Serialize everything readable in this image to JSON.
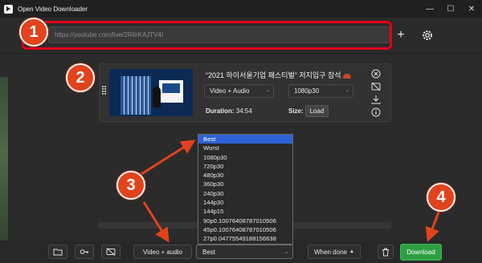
{
  "window": {
    "title": "Open Video Downloader",
    "controls": [
      "minimize",
      "maximize",
      "close"
    ]
  },
  "url_bar": {
    "value": "https://youtube.com/live/2R6rKAJTV4I",
    "add_label": "+"
  },
  "video": {
    "title": "“2021 하이서울기업 패스티벌” 저지입구 참석",
    "type": "Video + Audio",
    "quality": "1080p30",
    "duration_label": "Duration:",
    "duration": "34:54",
    "size_label": "Size:",
    "load_label": "Load"
  },
  "quality_menu": {
    "options": [
      "Best",
      "Worst",
      "1080p30",
      "720p30",
      "480p30",
      "360p30",
      "240p30",
      "144p30",
      "144p15",
      "90p0.1007640878701050​6",
      "45p0.10076408787010506",
      "27p0.04775549188156638"
    ],
    "selected": "Best"
  },
  "footer": {
    "type_select": "Video + audio",
    "quality_select": "Best",
    "when_done": "When done",
    "download": "Download"
  },
  "annotations": {
    "badges": [
      "1",
      "2",
      "3",
      "4"
    ],
    "color": "#e2431c"
  },
  "colors": {
    "accent_blue": "#2f62d6",
    "download_green": "#2ea043",
    "highlight_red": "#e0001a"
  }
}
